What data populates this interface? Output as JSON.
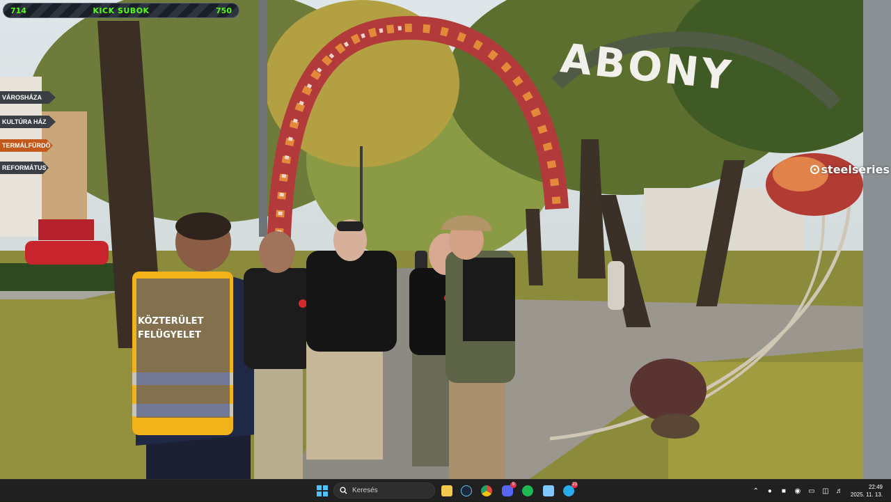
{
  "overlay": {
    "left_count": "714",
    "title": "KICK SUBOK",
    "right_count": "750"
  },
  "watermark": {
    "text": "steelseries"
  },
  "arch": {
    "sign_text": "ABONY"
  },
  "vest": {
    "line1": "KÖZTERÜLET",
    "line2": "FELÜGYELET"
  },
  "street_signs": [
    {
      "text": "VÁROSHÁZA",
      "color": "#3a3f46"
    },
    {
      "text": "KULTÚRA HÁZ",
      "color": "#3a3f46"
    },
    {
      "text": "TERMÁLFÜRDŐ",
      "color": "#c2581c"
    },
    {
      "text": "REFORMÁTUS",
      "color": "#3a3f46"
    }
  ],
  "taskbar": {
    "search_placeholder": "Keresés",
    "apps": [
      {
        "icon": "file-explorer-icon",
        "color": "#f2c94c"
      },
      {
        "icon": "steam-icon",
        "color": "#1b2838"
      },
      {
        "icon": "chrome-icon",
        "color": "#dd4b39"
      },
      {
        "icon": "discord-icon",
        "color": "#5865f2",
        "badge": "9"
      },
      {
        "icon": "spotify-icon",
        "color": "#1db954"
      },
      {
        "icon": "notepad-icon",
        "color": "#7ec8ff"
      },
      {
        "icon": "telegram-icon",
        "color": "#2aabee",
        "badge": "23"
      }
    ],
    "time": "22:49",
    "date": "2025. 11. 13."
  }
}
